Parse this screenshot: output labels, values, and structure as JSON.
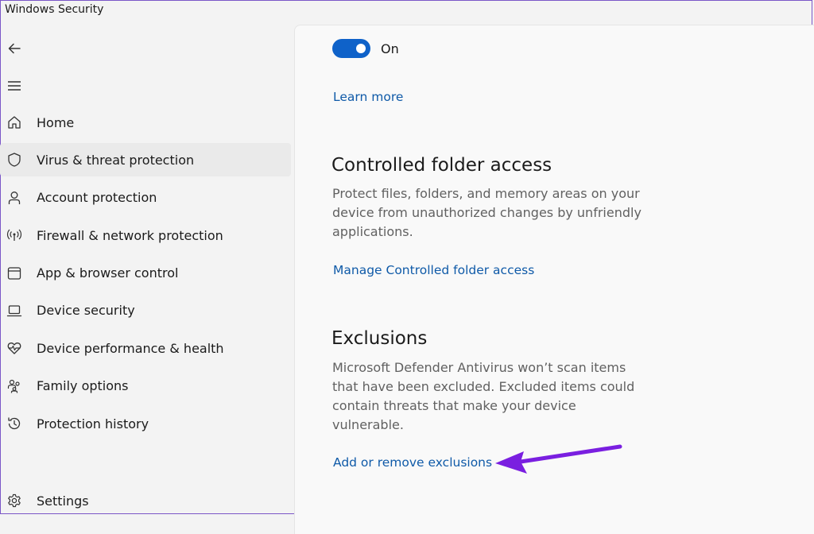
{
  "window": {
    "title": "Windows Security"
  },
  "sidebar": {
    "items": [
      {
        "label": "Home",
        "icon": "home-icon"
      },
      {
        "label": "Virus & threat protection",
        "icon": "shield-icon",
        "active": true
      },
      {
        "label": "Account protection",
        "icon": "person-icon"
      },
      {
        "label": "Firewall & network protection",
        "icon": "antenna-icon"
      },
      {
        "label": "App & browser control",
        "icon": "window-icon"
      },
      {
        "label": "Device security",
        "icon": "laptop-icon"
      },
      {
        "label": "Device performance & health",
        "icon": "heart-pulse-icon"
      },
      {
        "label": "Family options",
        "icon": "family-icon"
      },
      {
        "label": "Protection history",
        "icon": "history-icon"
      }
    ],
    "settings_label": "Settings"
  },
  "main": {
    "toggle": {
      "state_label": "On",
      "on": true
    },
    "learn_more": "Learn more",
    "cfa": {
      "title": "Controlled folder access",
      "description": "Protect files, folders, and memory areas on your device from unauthorized changes by unfriendly applications.",
      "link": "Manage Controlled folder access"
    },
    "exclusions": {
      "title": "Exclusions",
      "description": "Microsoft Defender Antivirus won’t scan items that have been excluded. Excluded items could contain threats that make your device vulnerable.",
      "link": "Add or remove exclusions"
    }
  },
  "colors": {
    "accent": "#0f62c9",
    "link": "#0f5aa8",
    "annotation_arrow": "#7a1fe0"
  }
}
